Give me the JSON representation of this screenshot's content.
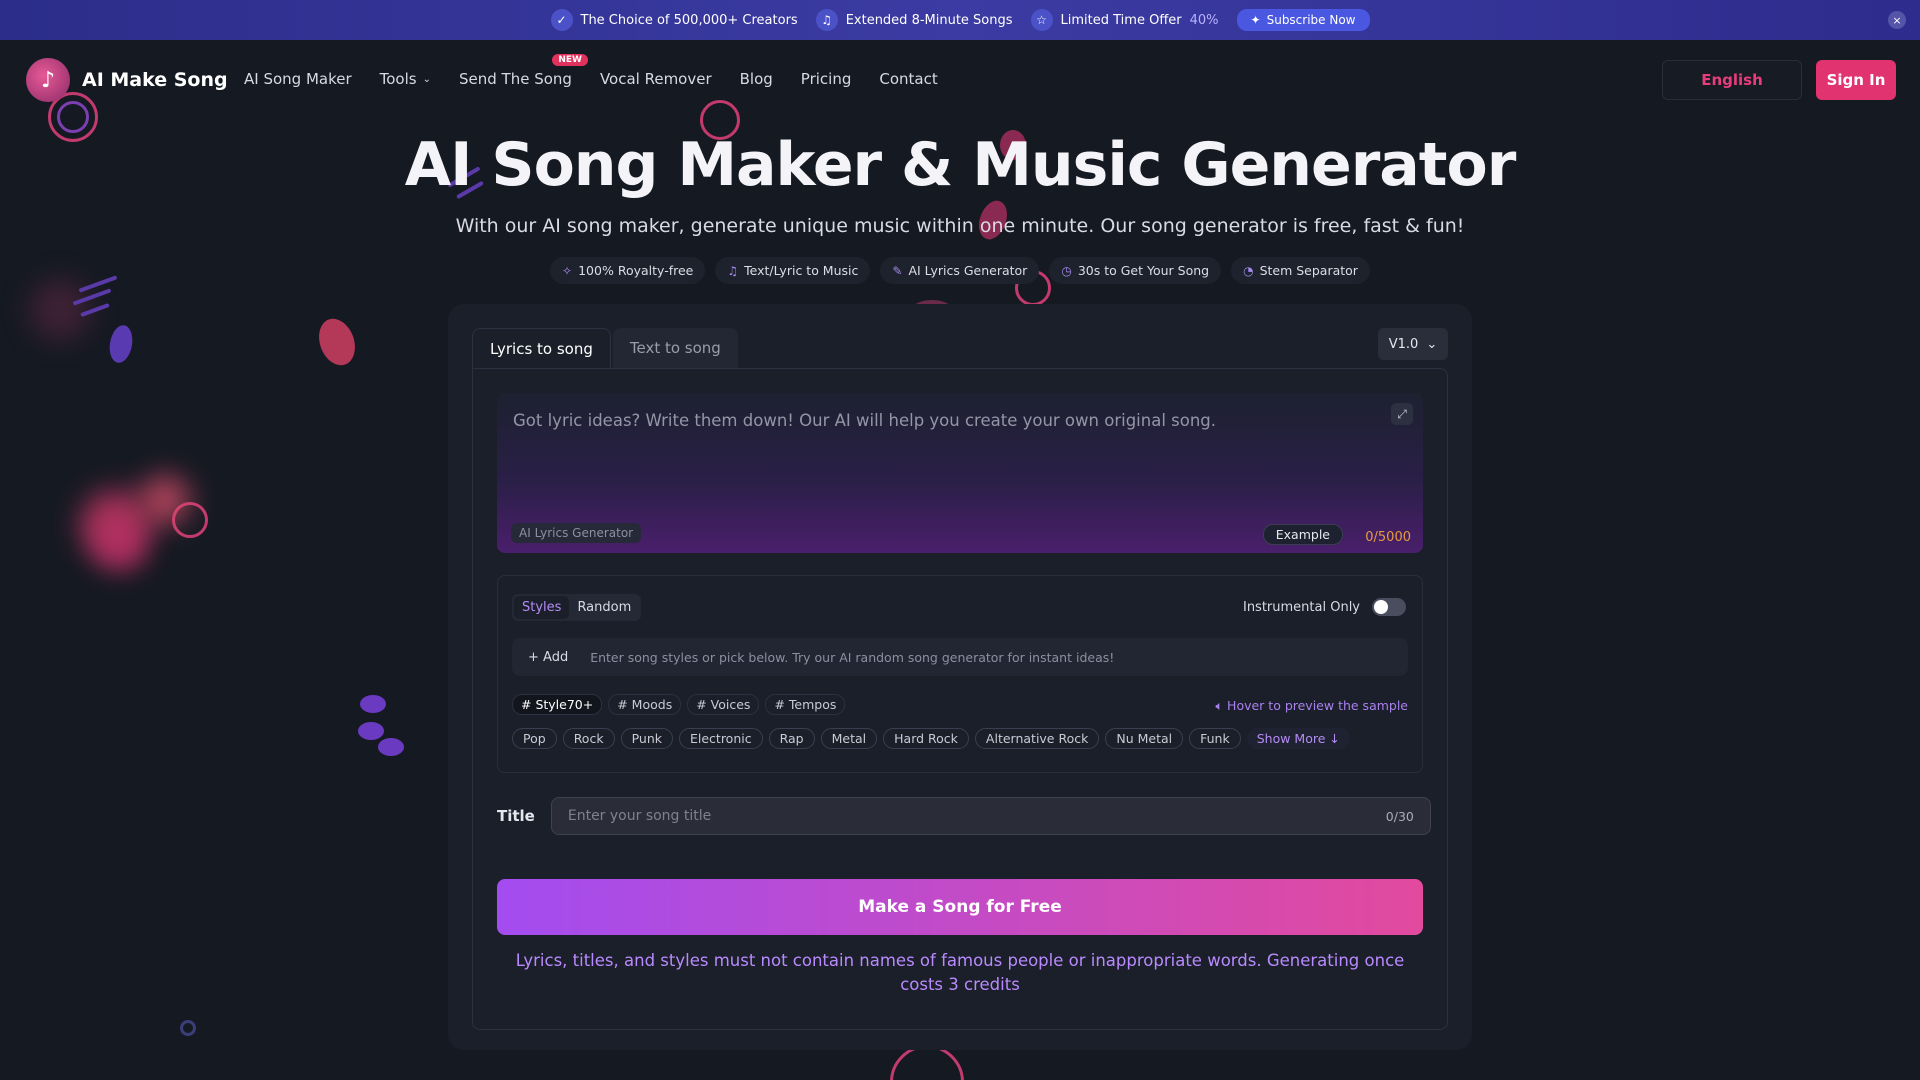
{
  "banner": {
    "item1": "The Choice of 500,000+ Creators",
    "item2": "Extended 8-Minute Songs",
    "item3": "Limited Time Offer",
    "item3_pct": "40%",
    "subscribe": "Subscribe Now",
    "close_icon": "×",
    "icons": [
      "check-badge-icon",
      "music-note-icon",
      "star-icon",
      "sparkle-icon"
    ]
  },
  "nav": {
    "logo_text": "AI Make Song",
    "items": [
      "AI Song Maker",
      "Tools",
      "Send The Song",
      "Vocal Remover",
      "Blog",
      "Pricing",
      "Contact"
    ],
    "new_badge": "NEW",
    "lang": "English",
    "signin": "Sign In"
  },
  "hero": {
    "title": "AI Song Maker & Music Generator",
    "subtitle": "With our AI song maker, generate unique music within one minute. Our song generator is free, fast & fun!",
    "features": [
      "100% Royalty-free",
      "Text/Lyric to Music",
      "AI Lyrics Generator",
      "30s to Get Your Song",
      "Stem Separator"
    ]
  },
  "card": {
    "tabs": [
      "Lyrics to song",
      "Text to song"
    ],
    "version": "V1.0",
    "lyrics_placeholder": "Got lyric ideas? Write them down! Our AI will help you create your own original song.",
    "ai_lyrics": "AI Lyrics Generator",
    "example": "Example",
    "lyrics_count": "0/5000",
    "style_tabs": [
      "Styles",
      "Random"
    ],
    "instrumental": "Instrumental Only",
    "add": "+ Add",
    "style_placeholder": "Enter song styles or pick below. Try our AI random song generator for instant ideas!",
    "categories": [
      "# Style​70+​",
      "# Moods",
      "# Voices",
      "# Tempos"
    ],
    "hover_note": "Hover to preview the sample",
    "tags": [
      "Pop",
      "Rock",
      "Punk",
      "Electronic",
      "Rap",
      "Metal",
      "Hard Rock",
      "Alternative Rock",
      "Nu Metal",
      "Funk"
    ],
    "show_more": "Show More ↓",
    "title_label": "Title",
    "title_placeholder": "Enter your song title",
    "title_count": "0/30",
    "make_button": "Make a Song for Free",
    "notice": "Lyrics, titles, and styles must not contain names of famous people or inappropriate words. Generating once costs 3 credits"
  },
  "colors": {
    "accent_pink": "#e0336f",
    "accent_purple": "#a34cf0",
    "background": "#151922"
  }
}
